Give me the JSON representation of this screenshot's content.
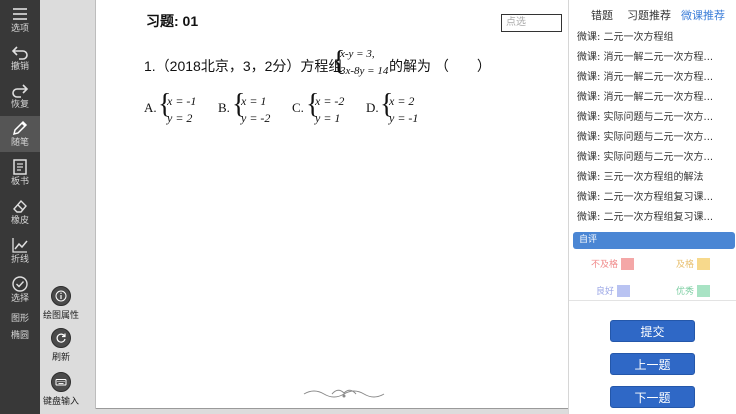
{
  "toolbar": {
    "items": [
      {
        "label": "选项",
        "icon": "menu-icon"
      },
      {
        "label": "撤销",
        "icon": "undo-icon"
      },
      {
        "label": "恢复",
        "icon": "redo-icon"
      },
      {
        "label": "随笔",
        "icon": "pencil-icon",
        "active": true
      },
      {
        "label": "板书",
        "icon": "document-icon"
      },
      {
        "label": "橡皮",
        "icon": "eraser-icon"
      },
      {
        "label": "折线",
        "icon": "polyline-icon"
      },
      {
        "label": "选择",
        "icon": "check-circle-icon"
      },
      {
        "label": "图形"
      },
      {
        "label": "椭圆"
      }
    ]
  },
  "float_tools": [
    {
      "label": "绘图属性",
      "icon": "info-icon"
    },
    {
      "label": "刷新",
      "icon": "refresh-icon"
    },
    {
      "label": "键盘输入",
      "icon": "keyboard-icon"
    }
  ],
  "question": {
    "title": "习题: 01",
    "pick_placeholder": "点选",
    "stem_prefix": "1.（2018北京，3，2分）方程组",
    "system_line1": "x-y = 3,",
    "system_line2": "3x-8y = 14",
    "stem_suffix": "的解为 （　　）",
    "options": [
      {
        "letter": "A.",
        "line1": "x = -1",
        "line2": "y = 2"
      },
      {
        "letter": "B.",
        "line1": "x = 1",
        "line2": "y = -2"
      },
      {
        "letter": "C.",
        "line1": "x = -2",
        "line2": "y = 1"
      },
      {
        "letter": "D.",
        "line1": "x = 2",
        "line2": "y = -1"
      }
    ]
  },
  "right_panel": {
    "tabs": [
      {
        "label": "错题",
        "active": false
      },
      {
        "label": "习题推荐",
        "active": false
      },
      {
        "label": "微课推荐",
        "active": true
      }
    ],
    "videos": [
      "微课: 二元一次方程组",
      "微课: 消元一解二元一次方程...",
      "微课: 消元一解二元一次方程...",
      "微课: 消元一解二元一次方程...",
      "微课: 实际问题与二元一次方...",
      "微课: 实际问题与二元一次方...",
      "微课: 实际问题与二元一次方...",
      "微课: 三元一次方程组的解法",
      "微课: 二元一次方程组复习课...",
      "微课: 二元一次方程组复习课..."
    ],
    "self_eval_title": "自评",
    "grades": [
      {
        "label": "不及格",
        "color": "#f4a7a7",
        "text_color": "#f08a8a"
      },
      {
        "label": "及格",
        "color": "#f7d98c",
        "text_color": "#e8c070"
      },
      {
        "label": "良好",
        "color": "#b9c3f2",
        "text_color": "#9aa6e6"
      },
      {
        "label": "优秀",
        "color": "#a8e3c4",
        "text_color": "#7fcfa4"
      }
    ],
    "buttons": {
      "submit": "提交",
      "prev": "上一题",
      "next": "下一题"
    }
  },
  "colors": {
    "toolbar_bg": "#383838",
    "accent": "#2f68c6",
    "tab_active": "#3b7dd8"
  }
}
